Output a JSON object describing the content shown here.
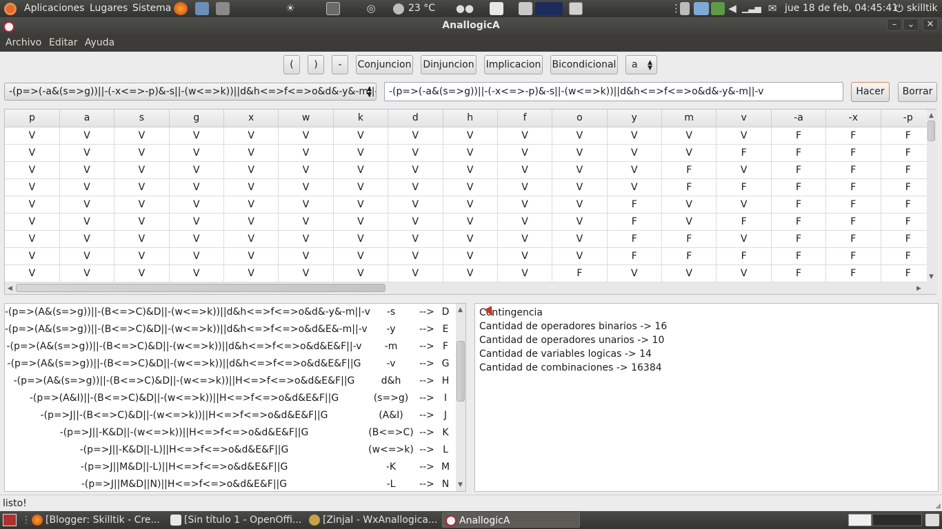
{
  "top_panel": {
    "menus": [
      "Aplicaciones",
      "Lugares",
      "Sistema"
    ],
    "weather": "23 °C",
    "datetime": "jue 18 de feb, 04:45:41",
    "user": "skilltik"
  },
  "window": {
    "title": "AnallogicA"
  },
  "menubar": [
    "Archivo",
    "Editar",
    "Ayuda"
  ],
  "toolbar": {
    "buttons": [
      "(",
      ")",
      "-",
      "Conjuncion",
      "Dinjuncion",
      "Implicacion",
      "Bicondicional"
    ],
    "variable_select": "a"
  },
  "formula": {
    "combo_value": "-(p=>(-a&(s=>g))||-(-x<=>-p)&-s||-(w<=>k))||d&h<=>f<=>o&d&-y&-m||-v",
    "input_value": "-(p=>(-a&(s=>g))||-(-x<=>-p)&-s||-(w<=>k))||d&h<=>f<=>o&d&-y&-m||-v",
    "hacer_label": "Hacer",
    "borrar_label": "Borrar"
  },
  "truth_table": {
    "headers": [
      "p",
      "a",
      "s",
      "g",
      "x",
      "w",
      "k",
      "d",
      "h",
      "f",
      "o",
      "y",
      "m",
      "v",
      "-a",
      "-x",
      "-p"
    ],
    "rows": [
      [
        "V",
        "V",
        "V",
        "V",
        "V",
        "V",
        "V",
        "V",
        "V",
        "V",
        "V",
        "V",
        "V",
        "V",
        "F",
        "F",
        "F"
      ],
      [
        "V",
        "V",
        "V",
        "V",
        "V",
        "V",
        "V",
        "V",
        "V",
        "V",
        "V",
        "V",
        "V",
        "F",
        "F",
        "F",
        "F"
      ],
      [
        "V",
        "V",
        "V",
        "V",
        "V",
        "V",
        "V",
        "V",
        "V",
        "V",
        "V",
        "V",
        "F",
        "V",
        "F",
        "F",
        "F"
      ],
      [
        "V",
        "V",
        "V",
        "V",
        "V",
        "V",
        "V",
        "V",
        "V",
        "V",
        "V",
        "V",
        "F",
        "F",
        "F",
        "F",
        "F"
      ],
      [
        "V",
        "V",
        "V",
        "V",
        "V",
        "V",
        "V",
        "V",
        "V",
        "V",
        "V",
        "F",
        "V",
        "V",
        "F",
        "F",
        "F"
      ],
      [
        "V",
        "V",
        "V",
        "V",
        "V",
        "V",
        "V",
        "V",
        "V",
        "V",
        "V",
        "F",
        "V",
        "F",
        "F",
        "F",
        "F"
      ],
      [
        "V",
        "V",
        "V",
        "V",
        "V",
        "V",
        "V",
        "V",
        "V",
        "V",
        "V",
        "F",
        "F",
        "V",
        "F",
        "F",
        "F"
      ],
      [
        "V",
        "V",
        "V",
        "V",
        "V",
        "V",
        "V",
        "V",
        "V",
        "V",
        "V",
        "F",
        "F",
        "F",
        "F",
        "F",
        "F"
      ],
      [
        "V",
        "V",
        "V",
        "V",
        "V",
        "V",
        "V",
        "V",
        "V",
        "V",
        "F",
        "V",
        "V",
        "V",
        "F",
        "F",
        "F"
      ]
    ]
  },
  "steps": [
    {
      "expr": "-(p=>(A&(s=>g))||-(B<=>C)&D||-(w<=>k))||d&h<=>f<=>o&d&-y&-m||-v",
      "sub": "-s",
      "arrow": "-->",
      "res": "D"
    },
    {
      "expr": "-(p=>(A&(s=>g))||-(B<=>C)&D||-(w<=>k))||d&h<=>f<=>o&d&E&-m||-v",
      "sub": "-y",
      "arrow": "-->",
      "res": "E"
    },
    {
      "expr": "-(p=>(A&(s=>g))||-(B<=>C)&D||-(w<=>k))||d&h<=>f<=>o&d&E&F||-v",
      "sub": "-m",
      "arrow": "-->",
      "res": "F"
    },
    {
      "expr": "-(p=>(A&(s=>g))||-(B<=>C)&D||-(w<=>k))||d&h<=>f<=>o&d&E&F||G",
      "sub": "-v",
      "arrow": "-->",
      "res": "G"
    },
    {
      "expr": "-(p=>(A&(s=>g))||-(B<=>C)&D||-(w<=>k))||H<=>f<=>o&d&E&F||G",
      "sub": "d&h",
      "arrow": "-->",
      "res": "H"
    },
    {
      "expr": "-(p=>(A&I)||-(B<=>C)&D||-(w<=>k))||H<=>f<=>o&d&E&F||G",
      "sub": "(s=>g)",
      "arrow": "-->",
      "res": "I"
    },
    {
      "expr": "-(p=>J||-(B<=>C)&D||-(w<=>k))||H<=>f<=>o&d&E&F||G",
      "sub": "(A&I)",
      "arrow": "-->",
      "res": "J"
    },
    {
      "expr": "-(p=>J||-K&D||-(w<=>k))||H<=>f<=>o&d&E&F||G",
      "sub": "(B<=>C)",
      "arrow": "-->",
      "res": "K"
    },
    {
      "expr": "-(p=>J||-K&D||-L)||H<=>f<=>o&d&E&F||G",
      "sub": "(w<=>k)",
      "arrow": "-->",
      "res": "L"
    },
    {
      "expr": "-(p=>J||M&D||-L)||H<=>f<=>o&d&E&F||G",
      "sub": "-K",
      "arrow": "-->",
      "res": "M"
    },
    {
      "expr": "-(p=>J||M&D||N)||H<=>f<=>o&d&E&F||G",
      "sub": "-L",
      "arrow": "-->",
      "res": "N"
    }
  ],
  "results": [
    "Contingencia",
    "Cantidad de operadores binarios -> 16",
    "Cantidad de operadores unarios -> 10",
    "Cantidad de variables logicas -> 14",
    "Cantidad de combinaciones -> 16384"
  ],
  "status": "listo!",
  "taskbar": [
    {
      "label": "[Blogger: Skilltik - Cre...",
      "icon": "firefox-icon"
    },
    {
      "label": "[Sin título 1 - OpenOffi...",
      "icon": "document-icon"
    },
    {
      "label": "[ZinjaI - WxAnallogica...",
      "icon": "zinjai-icon"
    },
    {
      "label": "AnallogicA",
      "icon": "app-icon"
    }
  ],
  "colors": {
    "panel": "#3c3b37",
    "window_bg": "#ececec",
    "accent": "#e26a2c"
  }
}
